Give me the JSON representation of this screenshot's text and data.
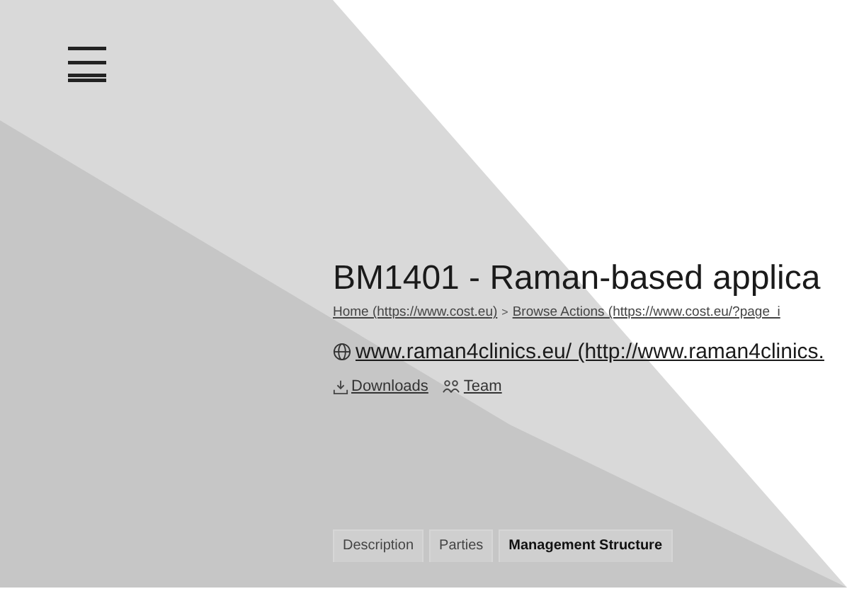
{
  "title": "BM1401 - Raman-based applica",
  "breadcrumb": [
    {
      "label": "Home (https://www.cost.eu)"
    },
    {
      "label": "Browse Actions (https://www.cost.eu/?page_i"
    }
  ],
  "breadcrumb_separator": ">",
  "website_link": "www.raman4clinics.eu/ (http://www.raman4clinics.",
  "links": [
    {
      "kind": "downloads",
      "label": "Downloads"
    },
    {
      "kind": "team",
      "label": "Team"
    }
  ],
  "tabs": [
    {
      "label": "Description",
      "selected": false
    },
    {
      "label": "Parties",
      "selected": false
    },
    {
      "label": "Management Structure",
      "selected": true
    }
  ]
}
